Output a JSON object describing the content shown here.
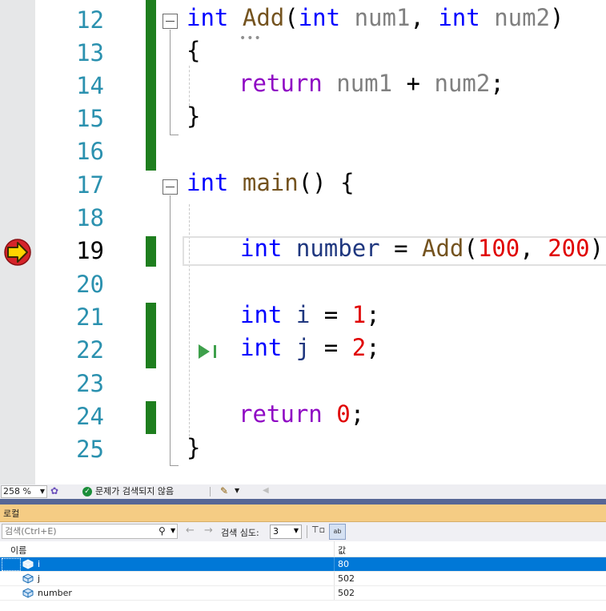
{
  "editor": {
    "lines": [
      {
        "num": "12"
      },
      {
        "num": "13"
      },
      {
        "num": "14"
      },
      {
        "num": "15"
      },
      {
        "num": "16"
      },
      {
        "num": "17"
      },
      {
        "num": "18"
      },
      {
        "num": "19"
      },
      {
        "num": "20"
      },
      {
        "num": "21"
      },
      {
        "num": "22"
      },
      {
        "num": "23"
      },
      {
        "num": "24"
      },
      {
        "num": "25"
      }
    ],
    "code": {
      "l12": {
        "t1": "int",
        "t2": "Add",
        "t3": "(",
        "t4": "int",
        "t5": "num1",
        "t6": ", ",
        "t7": "int",
        "t8": "num2",
        "t9": ")"
      },
      "l13": {
        "t1": "{"
      },
      "l14": {
        "t1": "return",
        "t2": "num1",
        "t3": " + ",
        "t4": "num2",
        "t5": ";"
      },
      "l15": {
        "t1": "}"
      },
      "l17": {
        "t1": "int",
        "t2": "main",
        "t3": "() {"
      },
      "l19": {
        "t1": "int",
        "t2": "number",
        "t3": " = ",
        "t4": "Add",
        "t5": "(",
        "t6": "100",
        "t7": ", ",
        "t8": "200",
        "t9": ");"
      },
      "l21": {
        "t1": "int",
        "t2": "i",
        "t3": " = ",
        "t4": "1",
        "t5": ";"
      },
      "l22": {
        "t1": "int",
        "t2": "j",
        "t3": " = ",
        "t4": "2",
        "t5": ";"
      },
      "l24": {
        "t1": "return",
        "t2": "0",
        "t3": ";"
      },
      "l25": {
        "t1": "}"
      }
    },
    "current_line": "19",
    "icons": {
      "instruction_pointer": "current-statement-arrow-icon",
      "run_to_click": "run-to-click-icon"
    }
  },
  "statusbar": {
    "zoom": "258 %",
    "issues": "문제가 검색되지 않음"
  },
  "locals": {
    "title": "로컬",
    "search_placeholder": "검색(Ctrl+E)",
    "depth_label": "검색 심도:",
    "depth_value": "3",
    "columns": {
      "name": "이름",
      "value": "값"
    },
    "rows": [
      {
        "name": "i",
        "value": "80",
        "selected": true
      },
      {
        "name": "j",
        "value": "502",
        "selected": false
      },
      {
        "name": "number",
        "value": "502",
        "selected": false
      }
    ]
  },
  "colors": {
    "keyword": "#0000ff",
    "control_keyword": "#8f08c4",
    "function": "#74531f",
    "number": "#e00000",
    "change_bar": "#1e7e1e",
    "locals_header": "#f5cc84",
    "selection": "#0078d7"
  }
}
